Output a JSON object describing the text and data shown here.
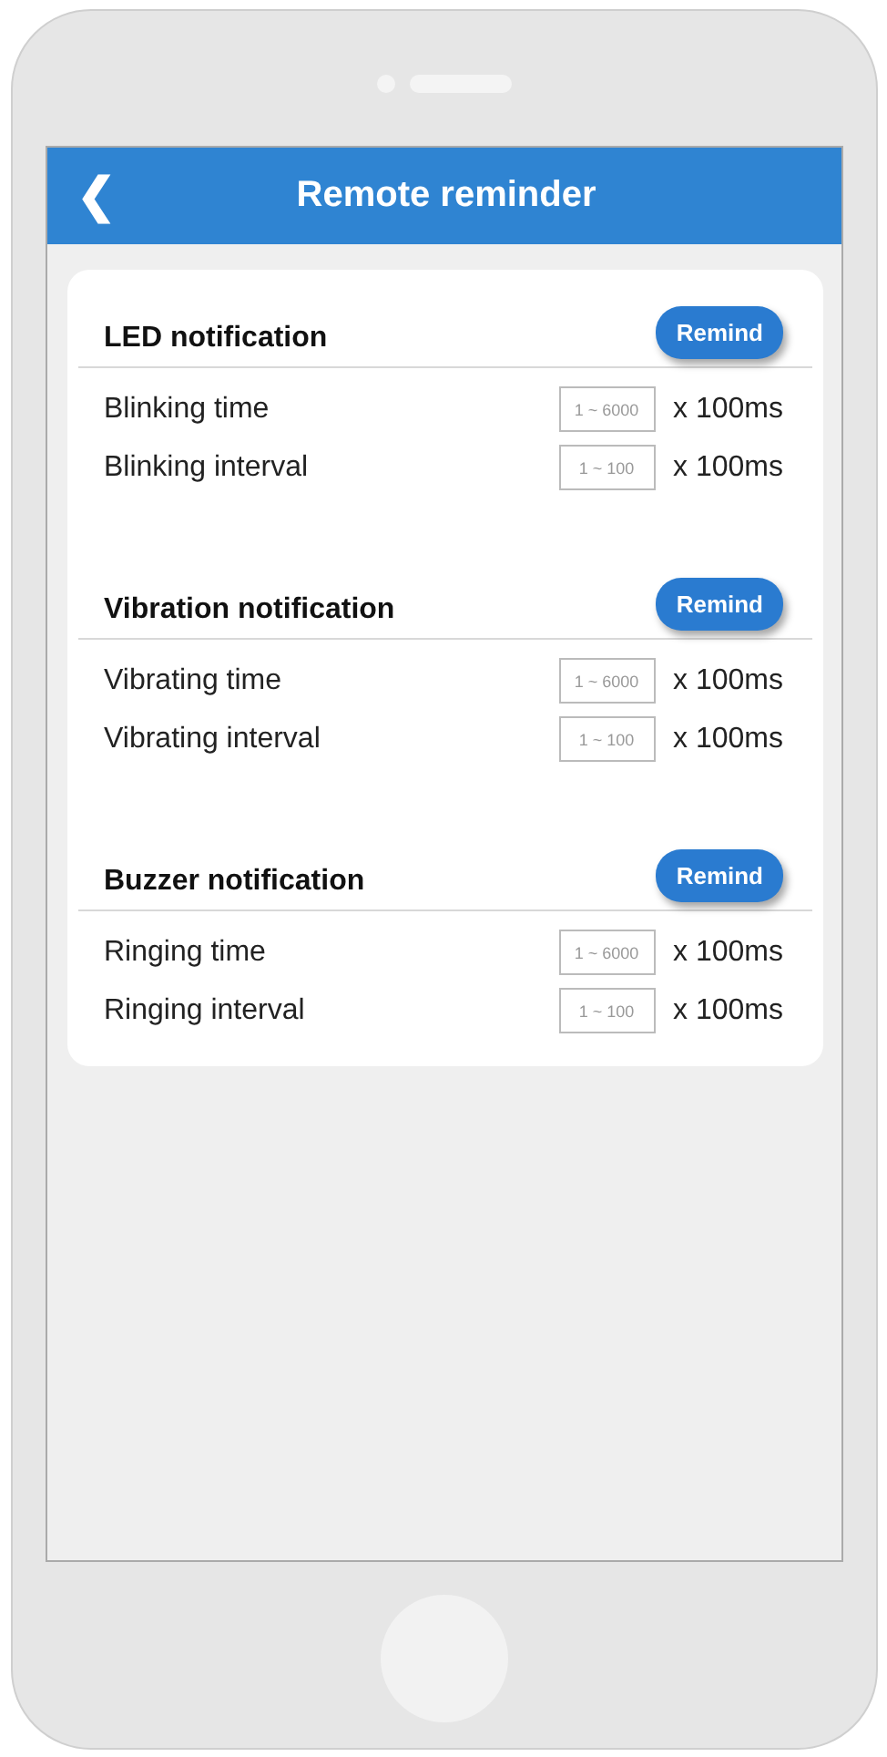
{
  "header": {
    "back": "❮",
    "title": "Remote reminder"
  },
  "sections": [
    {
      "title": "LED notification",
      "button": "Remind",
      "rows": [
        {
          "label": "Blinking time",
          "placeholder": "1 ~ 6000",
          "unit": "x 100ms"
        },
        {
          "label": "Blinking interval",
          "placeholder": "1 ~ 100",
          "unit": "x 100ms"
        }
      ]
    },
    {
      "title": "Vibration notification",
      "button": "Remind",
      "rows": [
        {
          "label": "Vibrating time",
          "placeholder": "1 ~ 6000",
          "unit": "x 100ms"
        },
        {
          "label": "Vibrating interval",
          "placeholder": "1 ~ 100",
          "unit": "x 100ms"
        }
      ]
    },
    {
      "title": "Buzzer notification",
      "button": "Remind",
      "rows": [
        {
          "label": "Ringing time",
          "placeholder": "1 ~ 6000",
          "unit": "x 100ms"
        },
        {
          "label": "Ringing interval",
          "placeholder": "1 ~ 100",
          "unit": "x 100ms"
        }
      ]
    }
  ]
}
